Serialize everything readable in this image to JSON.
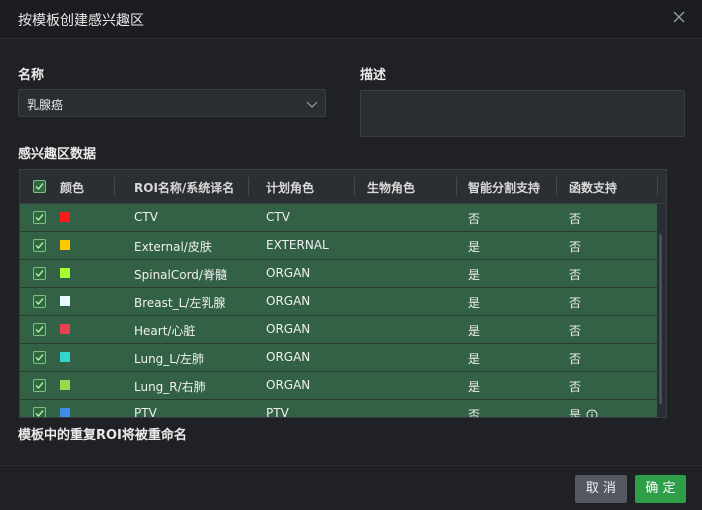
{
  "dialog": {
    "title": "按模板创建感兴趣区",
    "name_label": "名称",
    "name_value": "乳腺癌",
    "desc_label": "描述",
    "desc_value": "",
    "section_label": "感兴趣区数据",
    "note": "模板中的重复ROI将被重命名",
    "cancel_label": "取 消",
    "ok_label": "确 定"
  },
  "table": {
    "headers": [
      "颜色",
      "ROI名称/系统译名",
      "计划角色",
      "生物角色",
      "智能分割支持",
      "函数支持"
    ],
    "rows": [
      {
        "color": "#ff1a1a",
        "name": "CTV",
        "plan_role": "CTV",
        "bio_role": "",
        "smart_seg": "否",
        "func": "否",
        "info": false
      },
      {
        "color": "#ffc800",
        "name": "External/皮肤",
        "plan_role": "EXTERNAL",
        "bio_role": "",
        "smart_seg": "是",
        "func": "否",
        "info": false
      },
      {
        "color": "#a6ff33",
        "name": "SpinalCord/脊髓",
        "plan_role": "ORGAN",
        "bio_role": "",
        "smart_seg": "是",
        "func": "否",
        "info": false
      },
      {
        "color": "#e6fbff",
        "name": "Breast_L/左乳腺",
        "plan_role": "ORGAN",
        "bio_role": "",
        "smart_seg": "是",
        "func": "否",
        "info": false
      },
      {
        "color": "#e84050",
        "name": "Heart/心脏",
        "plan_role": "ORGAN",
        "bio_role": "",
        "smart_seg": "是",
        "func": "否",
        "info": false
      },
      {
        "color": "#33d6cc",
        "name": "Lung_L/左肺",
        "plan_role": "ORGAN",
        "bio_role": "",
        "smart_seg": "是",
        "func": "否",
        "info": false
      },
      {
        "color": "#99d94d",
        "name": "Lung_R/右肺",
        "plan_role": "ORGAN",
        "bio_role": "",
        "smart_seg": "是",
        "func": "否",
        "info": false
      },
      {
        "color": "#3d8ee6",
        "name": "PTV",
        "plan_role": "PTV",
        "bio_role": "",
        "smart_seg": "否",
        "func": "是",
        "info": true
      }
    ]
  }
}
